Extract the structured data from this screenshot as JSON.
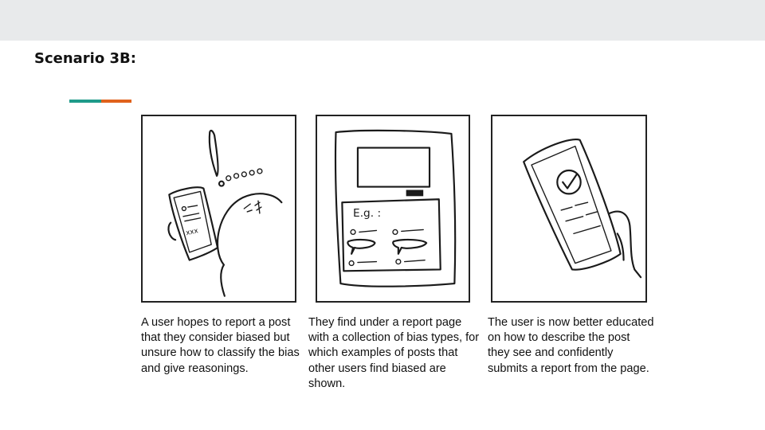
{
  "slide": {
    "title": "Scenario 3B:",
    "colors": {
      "accent_teal": "#1f9b8a",
      "accent_orange": "#e0621c",
      "top_band": "#e8eaeb"
    }
  },
  "panels": [
    {
      "sketch": "user-with-phone-and-exclamation-sketch",
      "phone_text": "xxx",
      "caption": "A user hopes to report a post that they consider biased but unsure how to classify the bias and give reasonings."
    },
    {
      "sketch": "report-page-with-bias-examples-sketch",
      "example_label": "E.g. :",
      "caption": "They find under a report page with a collection of bias types, for which examples of posts that other users find biased are shown."
    },
    {
      "sketch": "hand-holding-phone-with-checkmark-sketch",
      "caption": "The user is now better educated on how to describe the post they see and confidently submits a report from the page."
    }
  ]
}
